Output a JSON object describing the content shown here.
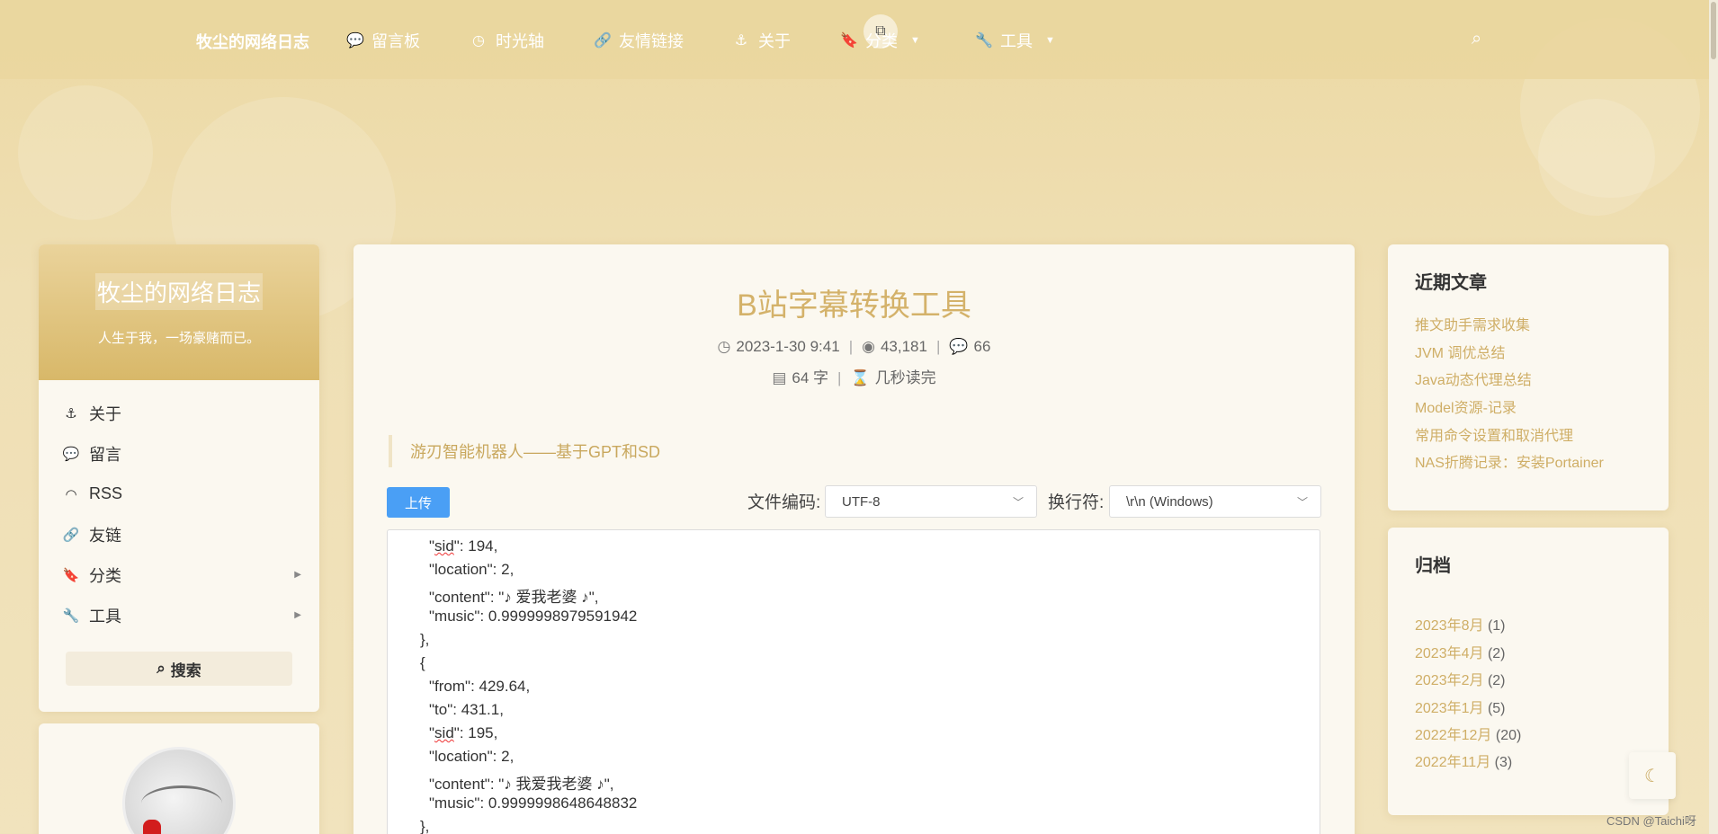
{
  "nav": {
    "brand": "牧尘的网络日志",
    "items": [
      {
        "label": "留言板",
        "icon": "comments-icon"
      },
      {
        "label": "时光轴",
        "icon": "clock-icon"
      },
      {
        "label": "友情链接",
        "icon": "link-icon"
      },
      {
        "label": "关于",
        "icon": "anchor-icon"
      },
      {
        "label": "分类",
        "icon": "bookmark-icon"
      },
      {
        "label": "工具",
        "icon": "wrench-icon"
      }
    ]
  },
  "profile": {
    "title": "牧尘的网络日志",
    "subtitle": "人生于我，一场豪赌而已。",
    "menu": [
      {
        "label": "关于",
        "icon": "anchor-icon"
      },
      {
        "label": "留言",
        "icon": "comments-icon"
      },
      {
        "label": "RSS",
        "icon": "rss-icon"
      },
      {
        "label": "友链",
        "icon": "link-icon"
      },
      {
        "label": "分类",
        "icon": "bookmark-icon"
      },
      {
        "label": "工具",
        "icon": "wrench-icon"
      }
    ],
    "search_label": "搜索"
  },
  "article": {
    "title": "B站字幕转换工具",
    "date": "2023-1-30 9:41",
    "views": "43,181",
    "comments": "66",
    "words": "64 字",
    "read_time": "几秒读完",
    "quote": "游刃智能机器人——基于GPT和SD",
    "upload_label": "上传",
    "encoding_label": "文件编码:",
    "encoding_value": "UTF-8",
    "newline_label": "换行符:",
    "newline_value": "\\r\\n (Windows)",
    "code": {
      "l1_key": "sid",
      "l1_rest": "\": 194,",
      "l2": "\"location\": 2,",
      "l3": "\"content\": \"♪ 爱我老婆 ♪\",",
      "l4": "\"music\": 0.9999998979591942",
      "l5": "},",
      "l6": "{",
      "l7": "\"from\": 429.64,",
      "l8": "\"to\": 431.1,",
      "l9_key": "sid",
      "l9_rest": "\": 195,",
      "l10": "\"location\": 2,",
      "l11": "\"content\": \"♪ 我爱我老婆 ♪\",",
      "l12": "\"music\": 0.9999998648648832",
      "l13": "},"
    }
  },
  "recent": {
    "title": "近期文章",
    "items": [
      "推文助手需求收集",
      "JVM 调优总结",
      "Java动态代理总结",
      "Model资源-记录",
      "常用命令设置和取消代理",
      "NAS折腾记录：安装Portainer"
    ]
  },
  "archive": {
    "title": "归档",
    "items": [
      {
        "month": "2023年8月",
        "count": "(1)"
      },
      {
        "month": "2023年4月",
        "count": "(2)"
      },
      {
        "month": "2023年2月",
        "count": "(2)"
      },
      {
        "month": "2023年1月",
        "count": "(5)"
      },
      {
        "month": "2022年12月",
        "count": "(20)"
      },
      {
        "month": "2022年11月",
        "count": "(3)"
      }
    ]
  },
  "watermark": "CSDN @Taichi呀",
  "colors": {
    "accent": "#d4b26a",
    "link": "#cfae66",
    "upload": "#4a9ff5"
  }
}
